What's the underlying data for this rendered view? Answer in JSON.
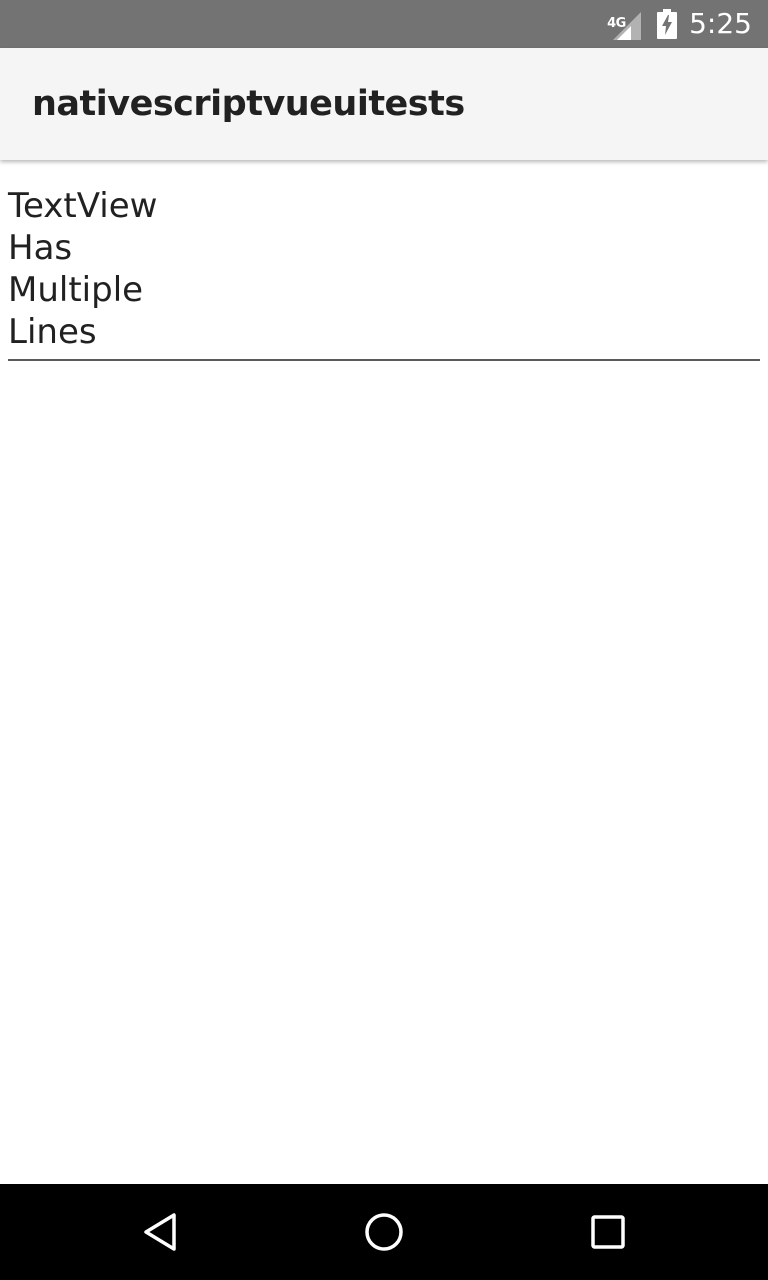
{
  "status_bar": {
    "network": "4G",
    "time": "5:25",
    "icons": [
      "signal-icon",
      "battery-charging-icon"
    ]
  },
  "action_bar": {
    "title": "nativescriptvueuitests"
  },
  "textview": {
    "lines": [
      "TextView",
      "Has",
      "Multiple",
      "Lines"
    ]
  },
  "nav_bar": {
    "icons": [
      "back-icon",
      "home-icon",
      "recents-icon"
    ]
  },
  "colors": {
    "status_bar": "#737373",
    "action_bar": "#f5f5f5",
    "title_text": "#212121",
    "underline": "#5a5a5a",
    "nav_bar": "#000000"
  }
}
